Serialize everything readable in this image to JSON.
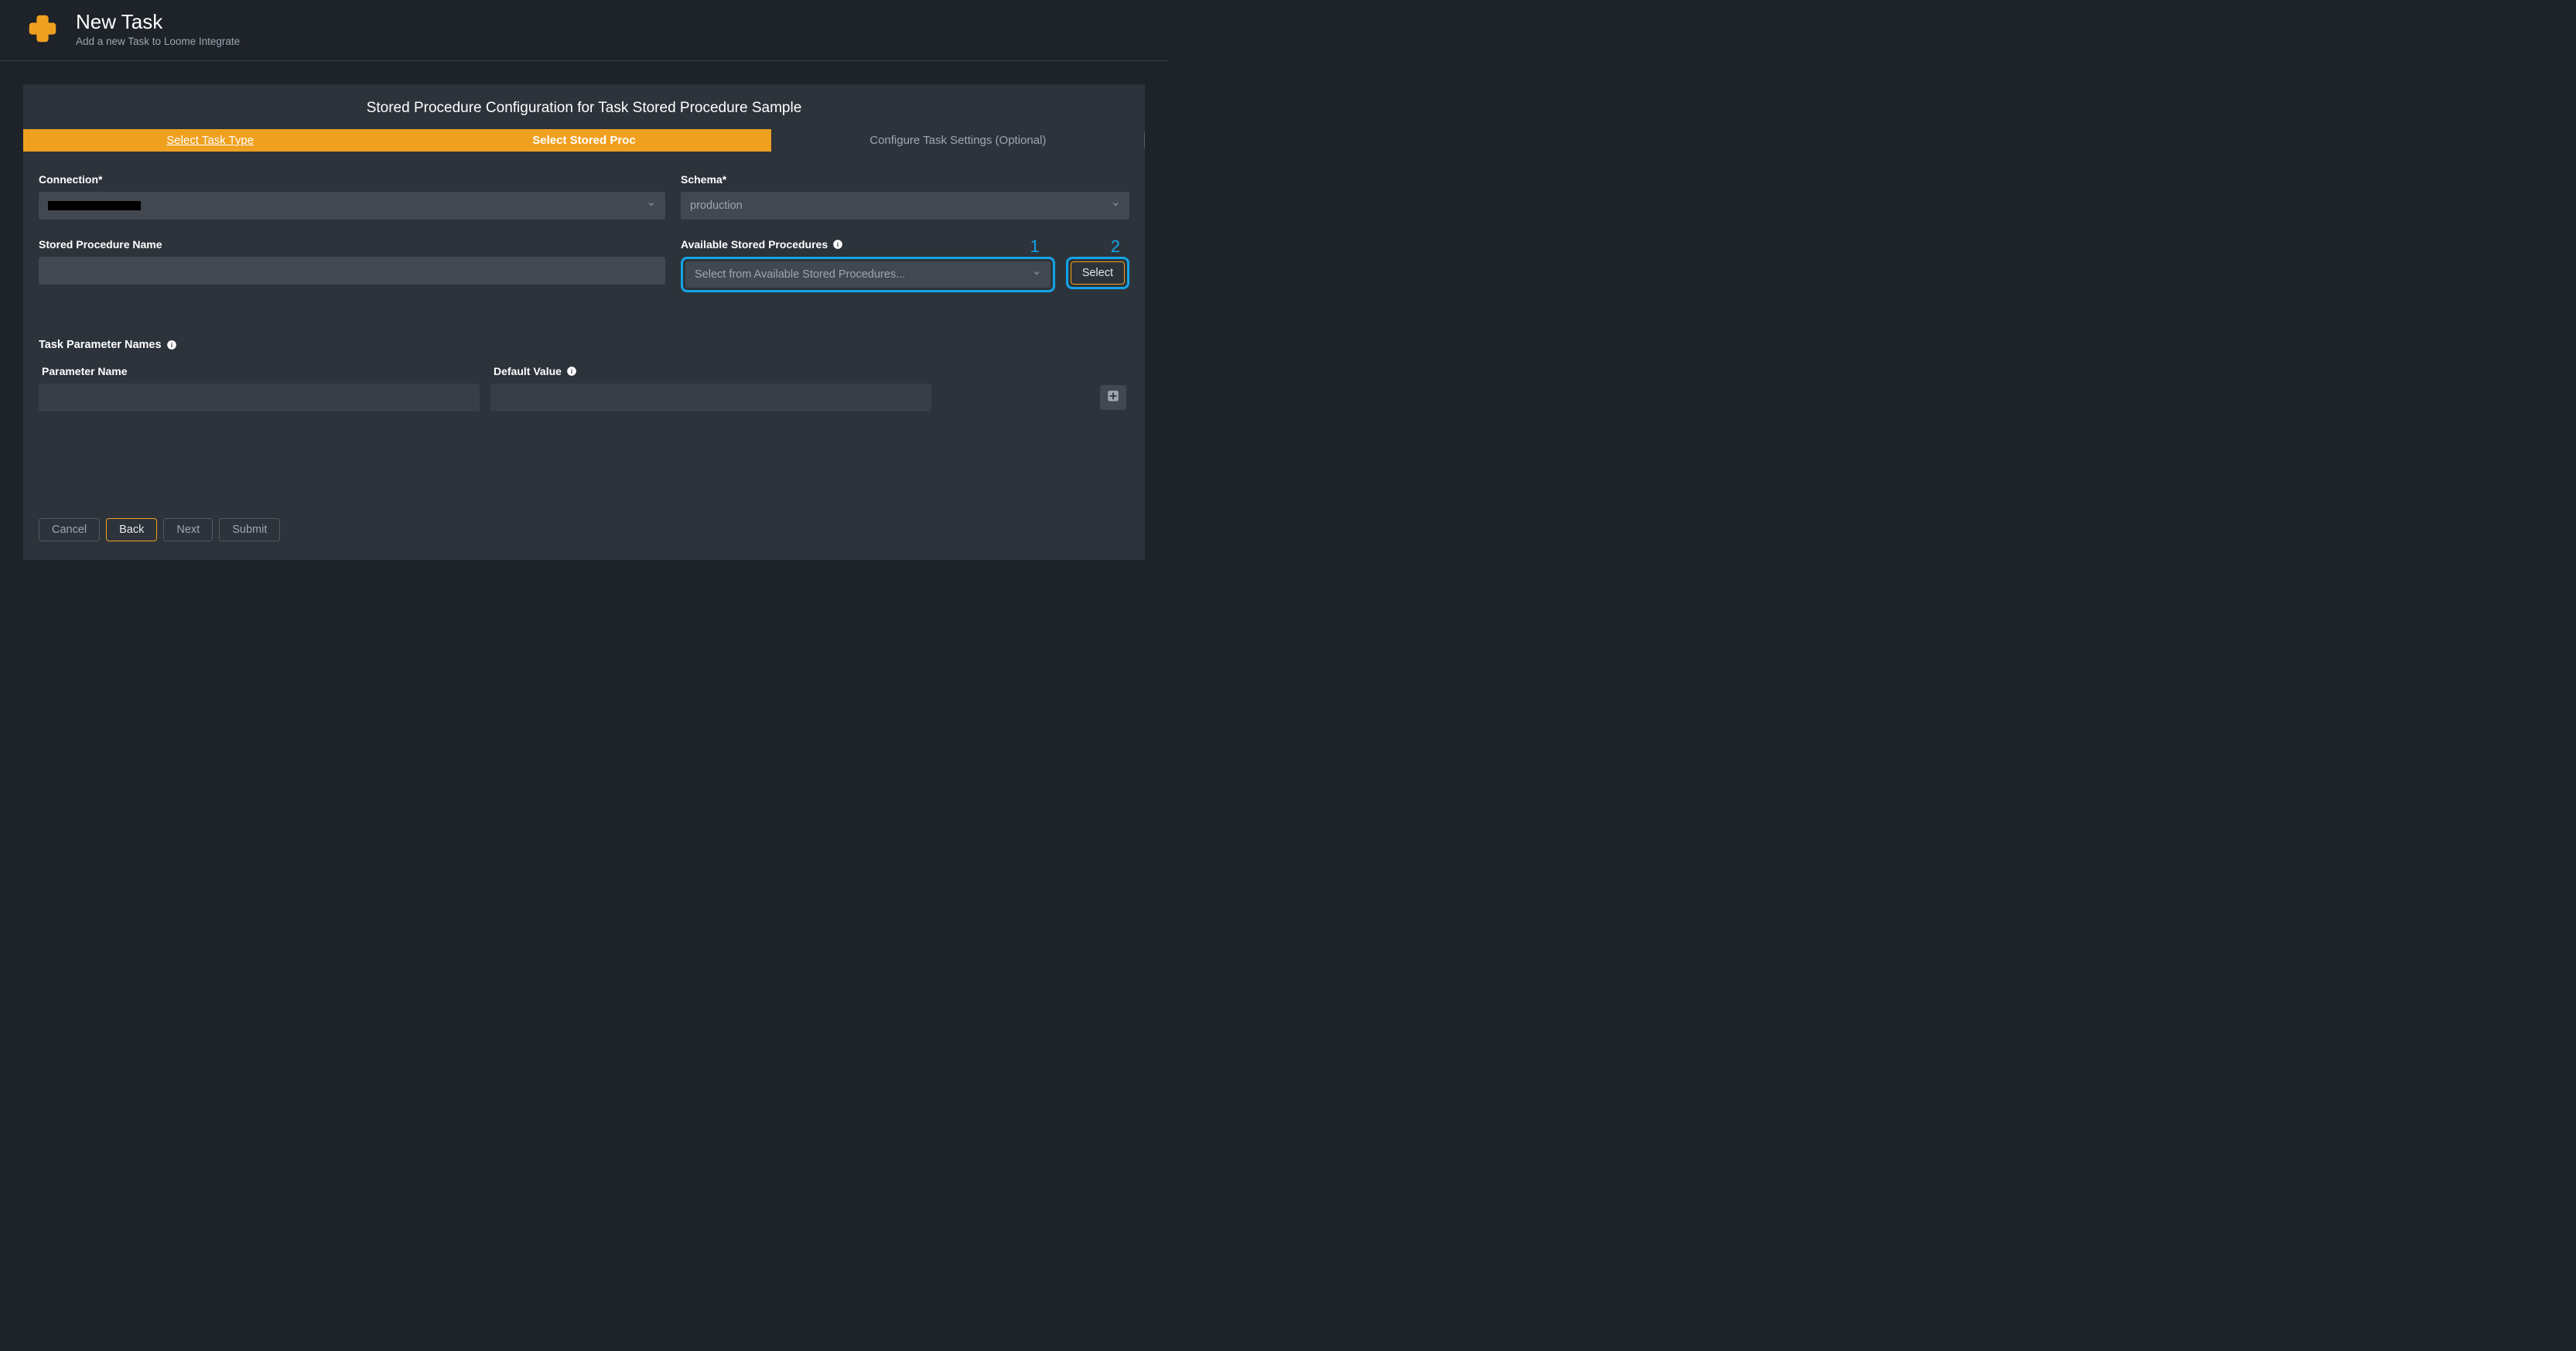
{
  "header": {
    "title": "New Task",
    "subtitle": "Add a new Task to Loome Integrate"
  },
  "panel": {
    "title": "Stored Procedure Configuration for Task Stored Procedure Sample"
  },
  "steps": {
    "0": {
      "label": "Select Task Type"
    },
    "1": {
      "label": "Select Stored Proc"
    },
    "2": {
      "label": "Configure Task Settings (Optional)"
    }
  },
  "fields": {
    "connection": {
      "label": "Connection*",
      "value_redacted": true
    },
    "schema": {
      "label": "Schema*",
      "value": "production"
    },
    "sp_name": {
      "label": "Stored Procedure Name",
      "value": ""
    },
    "available": {
      "label": "Available Stored Procedures",
      "placeholder": "Select from Available Stored Procedures...",
      "select_button": "Select"
    }
  },
  "annotations": {
    "available_number": "1",
    "select_number": "2"
  },
  "task_params": {
    "label": "Task Parameter Names",
    "columns": {
      "name": "Parameter Name",
      "default": "Default Value"
    },
    "rows": [
      {
        "name": "",
        "default": ""
      }
    ]
  },
  "footer": {
    "cancel": "Cancel",
    "back": "Back",
    "next": "Next",
    "submit": "Submit"
  }
}
